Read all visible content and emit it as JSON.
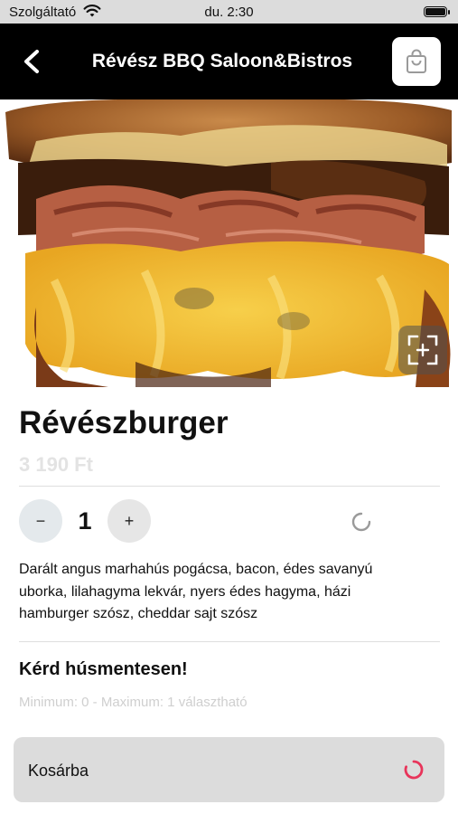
{
  "status_bar": {
    "carrier": "Szolgáltató",
    "time": "du. 2:30"
  },
  "nav": {
    "title": "Révész BBQ Saloon&Bistros",
    "back_icon": "chevron-left-icon",
    "cart_icon": "shopping-bag-icon"
  },
  "hero": {
    "zoom_icon": "expand-icon"
  },
  "product": {
    "name": "Révészburger",
    "price": "3 190 Ft",
    "quantity": "1",
    "minus_label": "−",
    "plus_label": "+",
    "description": "Darált angus marhahús pogácsa, bacon, édes savanyú uborka, lilahagyma lekvár, nyers édes hagyma, házi hamburger szósz, cheddar sajt szósz"
  },
  "option": {
    "title": "Kérd húsmentesen!",
    "hint": "Minimum: 0 - Maximum: 1 választható"
  },
  "cart_bar": {
    "label": "Kosárba"
  },
  "colors": {
    "accent": "#e8345a",
    "nav_bg": "#000000",
    "price": "#e3e3e3"
  }
}
